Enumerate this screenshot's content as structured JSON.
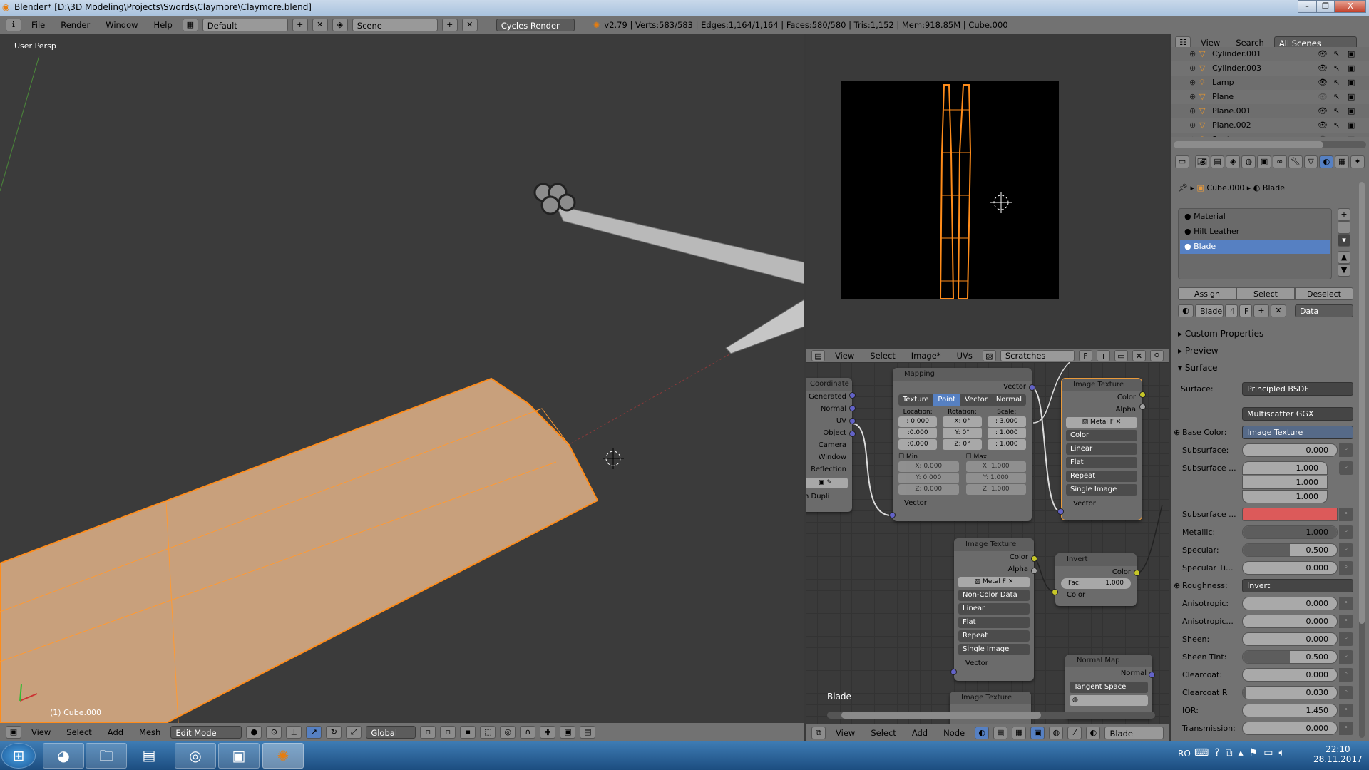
{
  "window": {
    "title": "Blender* [D:\\3D Modeling\\Projects\\Swords\\Claymore\\Claymore.blend]",
    "minimize": "–",
    "maximize": "❐",
    "close": "X"
  },
  "info_header": {
    "menus": [
      "File",
      "Render",
      "Window",
      "Help"
    ],
    "screen_layout": "Default",
    "scene": "Scene",
    "render_engine": "Cycles Render",
    "stats": "v2.79 | Verts:583/583 | Edges:1,164/1,164 | Faces:580/580 | Tris:1,152 | Mem:918.85M | Cube.000"
  },
  "viewport": {
    "view_name": "User Persp",
    "object_label": "(1) Cube.000",
    "colors": {
      "selection": "#ff8c1a",
      "mesh": "#c8a07c"
    },
    "header": {
      "menus": [
        "View",
        "Select",
        "Add",
        "Mesh"
      ],
      "mode": "Edit Mode",
      "orientation": "Global"
    }
  },
  "image_editor": {
    "menus": [
      "View",
      "Select",
      "Image*",
      "UVs"
    ],
    "image_name": "Scratches",
    "fake_user": "F"
  },
  "node_editor": {
    "material_label": "Blade",
    "header": {
      "menus": [
        "View",
        "Select",
        "Add",
        "Node"
      ],
      "material": "Blade"
    },
    "tex_coord": {
      "title": "Coordinate",
      "outputs": [
        "Generated",
        "Normal",
        "UV",
        "Object",
        "Camera",
        "Window",
        "Reflection"
      ],
      "dupli": "n Dupli"
    },
    "mapping": {
      "title": "Mapping",
      "output": "Vector",
      "modes": [
        "Texture",
        "Point",
        "Vector",
        "Normal"
      ],
      "active_mode": "Point",
      "location_label": "Location:",
      "rotation_label": "Rotation:",
      "scale_label": "Scale:",
      "location": [
        ": 0.000",
        ":0.000",
        ":0.000"
      ],
      "rotation": [
        "X:   0°",
        "Y:   0°",
        "Z:   0°"
      ],
      "scale": [
        ":  3.000",
        ": 1.000",
        ": 1.000"
      ],
      "min_label": "Min",
      "max_label": "Max",
      "min": [
        "X:    0.000",
        "Y:    0.000",
        "Z:    0.000"
      ],
      "max": [
        "X:    1.000",
        "Y:    1.000",
        "Z:    1.000"
      ],
      "input": "Vector"
    },
    "image_texture_1": {
      "title": "Image Texture",
      "outputs": [
        "Color",
        "Alpha"
      ],
      "image": "Metal",
      "fake": "F",
      "options": [
        "Color",
        "Linear",
        "Flat",
        "Repeat",
        "Single Image"
      ],
      "input": "Vector"
    },
    "image_texture_2": {
      "title": "Image Texture",
      "outputs": [
        "Color",
        "Alpha"
      ],
      "image": "Metal",
      "fake": "F",
      "options": [
        "Non-Color Data",
        "Linear",
        "Flat",
        "Repeat",
        "Single Image"
      ],
      "input": "Vector"
    },
    "image_texture_3": {
      "title": "Image Texture"
    },
    "invert": {
      "title": "Invert",
      "output": "Color",
      "fac_label": "Fac:",
      "fac": "1.000",
      "input": "Color"
    },
    "normal_map": {
      "title": "Normal Map",
      "output": "Normal",
      "space": "Tangent Space"
    }
  },
  "outliner": {
    "menus": [
      "View",
      "Search"
    ],
    "filter": "All Scenes",
    "items": [
      {
        "name": "Cylinder.001",
        "type": "mesh",
        "visible": true
      },
      {
        "name": "Cylinder.003",
        "type": "mesh",
        "visible": true
      },
      {
        "name": "Lamp",
        "type": "lamp",
        "visible": true
      },
      {
        "name": "Plane",
        "type": "mesh",
        "visible": false
      },
      {
        "name": "Plane.001",
        "type": "mesh",
        "visible": true
      },
      {
        "name": "Plane.002",
        "type": "mesh",
        "visible": true
      },
      {
        "name": "Spot",
        "type": "lamp",
        "visible": false
      }
    ]
  },
  "properties": {
    "breadcrumb": [
      "Cube.000",
      "Blade"
    ],
    "materials": [
      "Material",
      "Hilt Leather",
      "Blade"
    ],
    "selected_material": "Blade",
    "assign": "Assign",
    "select": "Select",
    "deselect": "Deselect",
    "material_name": "Blade",
    "users": "4",
    "fake": "F",
    "link": "Data",
    "panels": {
      "custom": "Custom Properties",
      "preview": "Preview",
      "surface": "Surface"
    },
    "surface_label": "Surface:",
    "surface": "Principled BSDF",
    "distribution": "Multiscatter GGX",
    "rows": [
      {
        "label": "Base Color:",
        "kind": "link",
        "value": "Image Texture"
      },
      {
        "label": "Subsurface:",
        "kind": "num",
        "value": "0.000",
        "fraction": 0
      },
      {
        "label": "Subsurface ...",
        "kind": "vec",
        "values": [
          "1.000",
          "1.000",
          "1.000"
        ]
      },
      {
        "label": "Subsurface ...",
        "kind": "color",
        "color": "#dc5a5a"
      },
      {
        "label": "Metallic:",
        "kind": "num",
        "value": "1.000",
        "fraction": 1
      },
      {
        "label": "Specular:",
        "kind": "num",
        "value": "0.500",
        "fraction": 0.5
      },
      {
        "label": "Specular Ti...",
        "kind": "num",
        "value": "0.000",
        "fraction": 0
      },
      {
        "label": "Roughness:",
        "kind": "link",
        "value": "Invert"
      },
      {
        "label": "Anisotropic:",
        "kind": "num",
        "value": "0.000",
        "fraction": 0
      },
      {
        "label": "Anisotropic...",
        "kind": "num",
        "value": "0.000",
        "fraction": 0
      },
      {
        "label": "Sheen:",
        "kind": "num",
        "value": "0.000",
        "fraction": 0
      },
      {
        "label": "Sheen Tint:",
        "kind": "num",
        "value": "0.500",
        "fraction": 0.5
      },
      {
        "label": "Clearcoat:",
        "kind": "num",
        "value": "0.000",
        "fraction": 0
      },
      {
        "label": "Clearcoat R",
        "kind": "num",
        "value": "0.030",
        "fraction": 0.03
      },
      {
        "label": "IOR:",
        "kind": "num",
        "value": "1.450",
        "fraction": 0
      },
      {
        "label": "Transmission:",
        "kind": "num",
        "value": "0.000",
        "fraction": 0
      }
    ]
  },
  "taskbar": {
    "apps": [
      "windows-start",
      "chrome",
      "explorer",
      "winrar",
      "cyberlink",
      "photos",
      "blender"
    ],
    "lang": "RO",
    "time": "22:10",
    "date": "28.11.2017"
  }
}
